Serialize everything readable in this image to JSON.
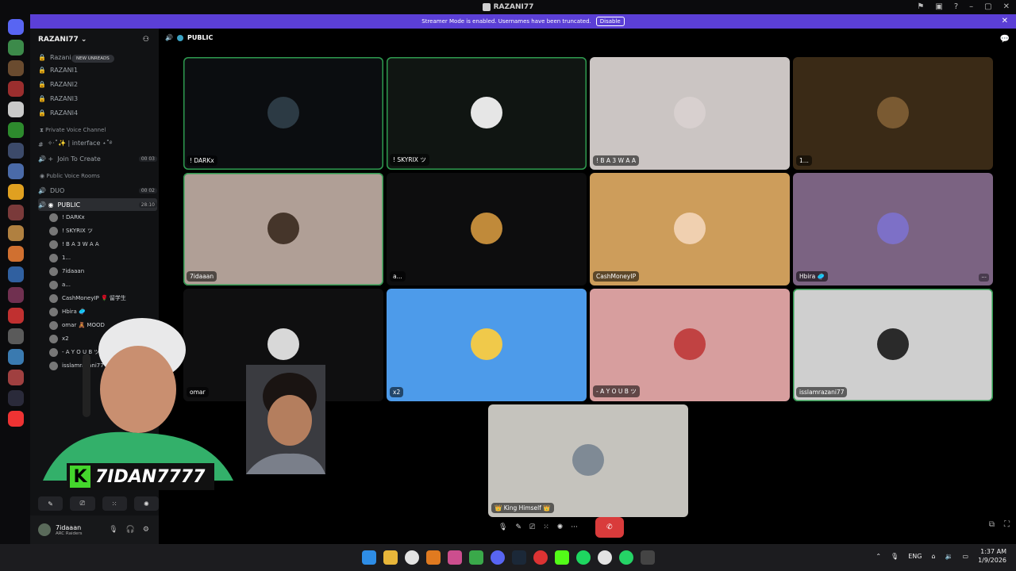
{
  "window": {
    "title": "RAZANI77"
  },
  "banner": {
    "text": "Streamer Mode is enabled. Usernames have been truncated.",
    "disable_label": "Disable"
  },
  "guild": {
    "name": "RAZANI77"
  },
  "new_unreads": "NEW UNREADS",
  "sidebar": {
    "channels": [
      {
        "label": "Razani",
        "count": ""
      },
      {
        "label": "RAZANI1",
        "count": ""
      },
      {
        "label": "RAZANI2",
        "count": ""
      },
      {
        "label": "RAZANI3",
        "count": ""
      },
      {
        "label": "RAZANI4",
        "count": ""
      }
    ],
    "cat_private": "Private Voice Channel",
    "interface": "✧·˚✨ | interface ⋆˚࿔",
    "join_to_create": "Join To Create",
    "join_count": "00 03",
    "cat_public": "Public Voice Rooms",
    "duo": "DUO",
    "duo_count": "00 02",
    "public": "PUBLIC",
    "public_count": "28:10",
    "members": [
      "! DARKx",
      "! SKYRIX ツ",
      "! B A 3 W A A",
      "1...",
      "7idaaan",
      "a...",
      "CashMoneyIP 🌹 留学生",
      "Hbira 🥏",
      "omar 🧸 MOOD",
      "x2",
      "- A Y O U B ツ",
      "isslamrazani77"
    ]
  },
  "voice_buttons": {
    "b1": "✎",
    "b2": "⎚",
    "b3": "⁙",
    "b4": "✺"
  },
  "self": {
    "name": "7idaaan",
    "status": "ARC Raiders"
  },
  "call": {
    "channel": "PUBLIC"
  },
  "tiles": [
    {
      "label": "! DARKx",
      "bg": "#0b0d10",
      "av": "#2c3a44"
    },
    {
      "label": "! SKYRIX ツ",
      "bg": "#101512",
      "av": "#e6e6e6"
    },
    {
      "label": "! B A 3 W A A",
      "bg": "#cbc5c3",
      "av": "#d8d0cf"
    },
    {
      "label": "1...",
      "bg": "#3a2a16",
      "av": "#7a5a32"
    },
    {
      "label": "7idaaan",
      "bg": "#b09f96",
      "av": "#45352a"
    },
    {
      "label": "a...",
      "bg": "#0d0d0e",
      "av": "#c08a3a"
    },
    {
      "label": "CashMoneyIP",
      "bg": "#cd9d5b",
      "av": "#f0d0b0"
    },
    {
      "label": "Hbira 🥏",
      "bg": "#7b6382",
      "av": "#7d70c7"
    },
    {
      "label": "omar",
      "bg": "#0f0f10",
      "av": "#d8d8d8"
    },
    {
      "label": "x2",
      "bg": "#4d9bea",
      "av": "#f0c94a"
    },
    {
      "label": "- A Y O U B ツ",
      "bg": "#d79e9e",
      "av": "#c14242"
    },
    {
      "label": "isslamrazani77",
      "bg": "#cfcfcf",
      "av": "#2a2a2a"
    },
    {
      "label": "👑 King Himself 👑",
      "bg": "#c5c3bd",
      "av": "#7f8a95"
    }
  ],
  "controls": {
    "mic": "🎙",
    "cam": "✎",
    "share": "⎚",
    "grid": "⁙",
    "activity": "✺",
    "more": "···",
    "hangup": "✆"
  },
  "streamer": {
    "logo": "K",
    "handle": "7IDAN7777"
  },
  "taskbar": {
    "lang": "ENG",
    "time": "1:37 AM",
    "date": "1/9/2026"
  }
}
